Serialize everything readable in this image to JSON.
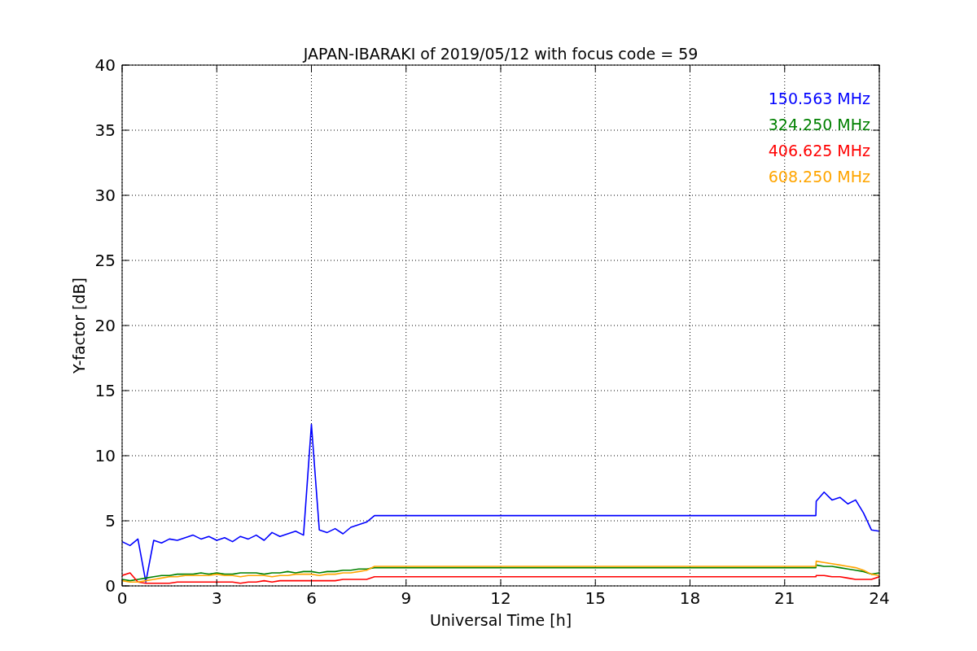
{
  "figure": {
    "chart_data": {
      "type": "line",
      "title": "JAPAN-IBARAKI of 2019/05/12 with focus code = 59",
      "xlabel": "Universal Time [h]",
      "ylabel": "Y-factor [dB]",
      "x": [
        0,
        0.25,
        0.5,
        0.75,
        1,
        1.25,
        1.5,
        1.75,
        2,
        2.25,
        2.5,
        2.75,
        3,
        3.25,
        3.5,
        3.75,
        4,
        4.25,
        4.5,
        4.75,
        5,
        5.25,
        5.5,
        5.75,
        6,
        6.25,
        6.5,
        6.75,
        7,
        7.25,
        7.5,
        7.75,
        8,
        21.99,
        22,
        22.25,
        22.5,
        22.75,
        23,
        23.25,
        23.5,
        23.75,
        24
      ],
      "series": [
        {
          "name": "150.563 MHz",
          "color": "#0000ff",
          "values": [
            3.4,
            3.1,
            3.6,
            0.3,
            3.5,
            3.3,
            3.6,
            3.5,
            3.7,
            3.9,
            3.6,
            3.8,
            3.5,
            3.7,
            3.4,
            3.8,
            3.6,
            3.9,
            3.5,
            4.1,
            3.8,
            4.0,
            4.2,
            3.9,
            12.4,
            4.3,
            4.1,
            4.4,
            4.0,
            4.5,
            4.7,
            4.9,
            5.4,
            5.4,
            6.5,
            7.2,
            6.6,
            6.8,
            6.3,
            6.6,
            5.6,
            4.3,
            4.2
          ]
        },
        {
          "name": "324.250 MHz",
          "color": "#008000",
          "values": [
            0.5,
            0.4,
            0.5,
            0.6,
            0.7,
            0.8,
            0.8,
            0.9,
            0.9,
            0.9,
            1.0,
            0.9,
            1.0,
            0.9,
            0.9,
            1.0,
            1.0,
            1.0,
            0.9,
            1.0,
            1.0,
            1.1,
            1.0,
            1.1,
            1.1,
            1.0,
            1.1,
            1.1,
            1.2,
            1.2,
            1.3,
            1.3,
            1.4,
            1.4,
            1.6,
            1.5,
            1.5,
            1.4,
            1.3,
            1.2,
            1.1,
            0.9,
            1.0
          ]
        },
        {
          "name": "406.625 MHz",
          "color": "#ff0000",
          "values": [
            0.8,
            1.0,
            0.3,
            0.2,
            0.2,
            0.2,
            0.2,
            0.3,
            0.3,
            0.3,
            0.3,
            0.3,
            0.3,
            0.3,
            0.3,
            0.2,
            0.3,
            0.3,
            0.4,
            0.3,
            0.4,
            0.4,
            0.4,
            0.4,
            0.4,
            0.4,
            0.4,
            0.4,
            0.5,
            0.5,
            0.5,
            0.5,
            0.7,
            0.7,
            0.8,
            0.8,
            0.7,
            0.7,
            0.6,
            0.5,
            0.5,
            0.5,
            0.7
          ]
        },
        {
          "name": "608.250 MHz",
          "color": "#ffa500",
          "values": [
            0.4,
            0.3,
            0.3,
            0.4,
            0.5,
            0.6,
            0.7,
            0.7,
            0.8,
            0.8,
            0.8,
            0.8,
            0.9,
            0.8,
            0.8,
            0.7,
            0.8,
            0.8,
            0.8,
            0.7,
            0.8,
            0.8,
            0.9,
            0.9,
            0.9,
            0.8,
            0.9,
            0.9,
            1.0,
            1.0,
            1.1,
            1.2,
            1.5,
            1.5,
            1.9,
            1.8,
            1.7,
            1.6,
            1.5,
            1.4,
            1.2,
            0.9,
            0.8
          ]
        }
      ],
      "grid": true,
      "xlim": [
        0,
        24
      ],
      "ylim": [
        0,
        40
      ],
      "xticks": [
        0,
        3,
        6,
        9,
        12,
        15,
        18,
        21,
        24
      ],
      "yticks": [
        0,
        5,
        10,
        15,
        20,
        25,
        30,
        35,
        40
      ]
    }
  }
}
